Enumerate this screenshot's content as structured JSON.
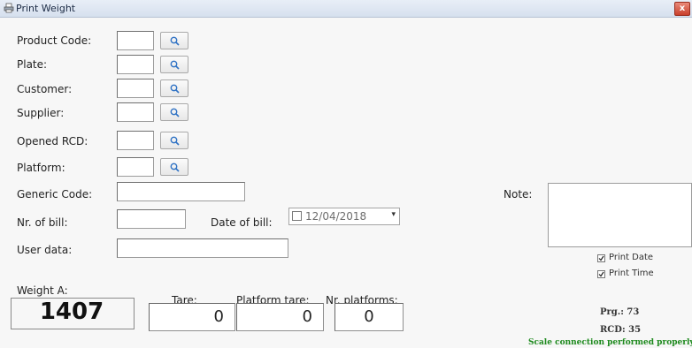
{
  "window": {
    "title": "Print Weight",
    "close_symbol": "x"
  },
  "form": {
    "product_code": {
      "label": "Product Code:",
      "value": ""
    },
    "plate": {
      "label": "Plate:",
      "value": ""
    },
    "customer": {
      "label": "Customer:",
      "value": ""
    },
    "supplier": {
      "label": "Supplier:",
      "value": ""
    },
    "opened_rcd": {
      "label": "Opened RCD:",
      "value": ""
    },
    "platform": {
      "label": "Platform:",
      "value": ""
    },
    "generic_code": {
      "label": "Generic Code:",
      "value": ""
    },
    "nr_of_bill": {
      "label": "Nr. of bill:",
      "value": ""
    },
    "date_of_bill": {
      "label": "Date of bill:",
      "value": "12/04/2018",
      "checked": false,
      "dropdown_symbol": "▾"
    },
    "user_data": {
      "label": "User data:",
      "value": ""
    },
    "note": {
      "label": "Note:",
      "value": ""
    }
  },
  "options": {
    "print_date": {
      "label": "Print Date",
      "checked": true
    },
    "print_time": {
      "label": "Print Time",
      "checked": true
    }
  },
  "weights": {
    "weight_a_label": "Weight A:",
    "weight_a_value": "1407",
    "tare_label": "Tare:",
    "tare_value": "0",
    "platform_tare_label": "Platform tare:",
    "platform_tare_value": "0",
    "nr_platforms_label": "Nr. platforms:",
    "nr_platforms_value": "0"
  },
  "status": {
    "prg": "Prg.: 73",
    "rcd": "RCD: 35",
    "message": "Scale connection performed properly",
    "message_color": "#1e8a1e"
  },
  "icons": [
    "printer-icon",
    "close-icon",
    "search-icon",
    "checkmark-icon",
    "dropdown-arrow-icon"
  ]
}
